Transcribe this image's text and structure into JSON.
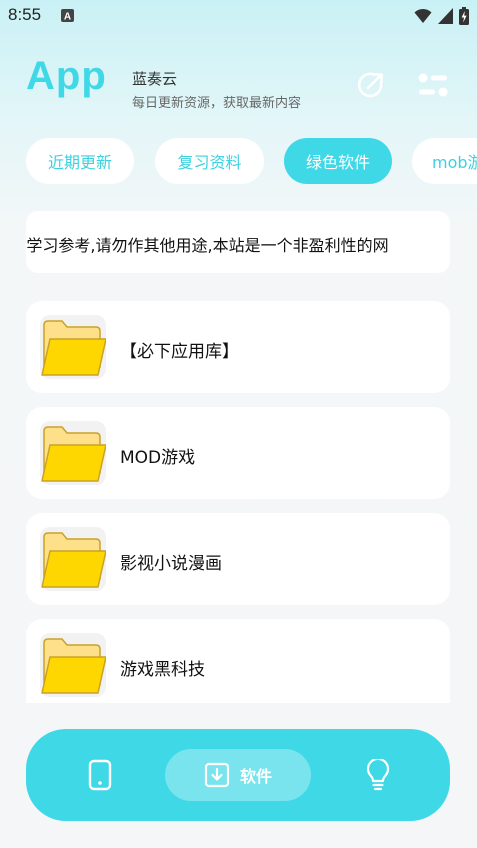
{
  "status_bar": {
    "time": "8:55",
    "app_icon": "a-app-icon",
    "icons": [
      "wifi-icon",
      "cellular-signal-icon",
      "battery-charging-icon"
    ]
  },
  "header": {
    "logo": "App",
    "title": "蓝奏云",
    "subtitle": "每日更新资源，获取最新内容",
    "share_icon": "share-icon",
    "settings_icon": "settings-toggle-icon"
  },
  "tabs": [
    {
      "label": "近期更新",
      "active": false
    },
    {
      "label": "复习资料",
      "active": false
    },
    {
      "label": "绿色软件",
      "active": true
    },
    {
      "label": "mob游",
      "active": false
    }
  ],
  "notice": {
    "text": "!学习参考,请勿作其他用途,本站是一个非盈利性的网"
  },
  "folders": [
    {
      "label": "【必下应用库】",
      "icon": "folder-icon"
    },
    {
      "label": "MOD游戏",
      "icon": "folder-icon"
    },
    {
      "label": "影视小说漫画",
      "icon": "folder-icon"
    },
    {
      "label": "游戏黑科技",
      "icon": "folder-icon"
    }
  ],
  "bottom_nav": {
    "left_icon": "phone-icon",
    "active_icon": "download-icon",
    "active_label": "软件",
    "right_icon": "lightbulb-icon"
  },
  "colors": {
    "accent": "#3fd8e6",
    "folder_fill": "#ffd700",
    "folder_back": "#ffe08a",
    "folder_stroke": "#c9a227"
  }
}
